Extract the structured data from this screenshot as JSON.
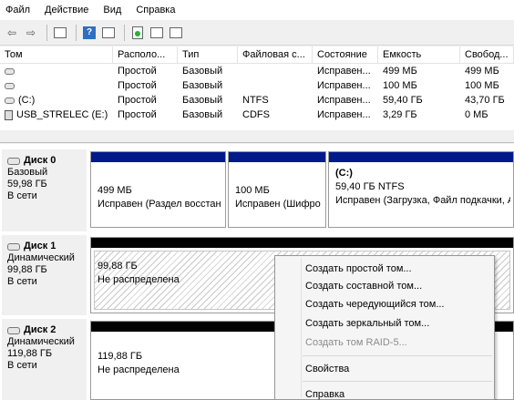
{
  "menu": [
    "Файл",
    "Действие",
    "Вид",
    "Справка"
  ],
  "toolbar": [
    "back-icon",
    "forward-icon",
    "console-tree-icon",
    "help-icon",
    "properties-icon",
    "refresh-icon",
    "rescan-icon",
    "view-icon"
  ],
  "volumes": {
    "columns": [
      "Том",
      "Располо...",
      "Тип",
      "Файловая с...",
      "Состояние",
      "Емкость",
      "Свобод..."
    ],
    "rows": [
      {
        "name": "",
        "layout": "Простой",
        "type": "Базовый",
        "fs": "",
        "status": "Исправен...",
        "capacity": "499 МБ",
        "free": "499 МБ"
      },
      {
        "name": "",
        "layout": "Простой",
        "type": "Базовый",
        "fs": "",
        "status": "Исправен...",
        "capacity": "100 МБ",
        "free": "100 МБ"
      },
      {
        "name": "(C:)",
        "layout": "Простой",
        "type": "Базовый",
        "fs": "NTFS",
        "status": "Исправен...",
        "capacity": "59,40 ГБ",
        "free": "43,70 ГБ"
      },
      {
        "name": "USB_STRELEC (E:)",
        "layout": "Простой",
        "type": "Базовый",
        "fs": "CDFS",
        "status": "Исправен...",
        "capacity": "3,29 ГБ",
        "free": "0 МБ"
      }
    ]
  },
  "disks": [
    {
      "title": "Диск 0",
      "kind": "Базовый",
      "size": "59,98 ГБ",
      "state": "В сети",
      "partitions": [
        {
          "label": "",
          "line1": "499 МБ",
          "line2": "Исправен (Раздел восстан"
        },
        {
          "label": "",
          "line1": "100 МБ",
          "line2": "Исправен (Шифро"
        },
        {
          "label": "(C:)",
          "line1": "59,40 ГБ NTFS",
          "line2": "Исправен (Загрузка, Файл подкачки, Ав"
        }
      ]
    },
    {
      "title": "Диск 1",
      "kind": "Динамический",
      "size": "99,88 ГБ",
      "state": "В сети",
      "partitions": [
        {
          "line1": "99,88 ГБ",
          "line2": "Не распределена"
        }
      ]
    },
    {
      "title": "Диск 2",
      "kind": "Динамический",
      "size": "119,88 ГБ",
      "state": "В сети",
      "partitions": [
        {
          "line1": "119,88 ГБ",
          "line2": "Не распределена"
        }
      ]
    }
  ],
  "context_menu": {
    "items": [
      {
        "label": "Создать простой том...",
        "enabled": true
      },
      {
        "label": "Создать составной том...",
        "enabled": true
      },
      {
        "label": "Создать чередующийся том...",
        "enabled": true
      },
      {
        "label": "Создать зеркальный том...",
        "enabled": true
      },
      {
        "label": "Создать том RAID-5...",
        "enabled": false
      },
      {
        "label": "Свойства",
        "enabled": true
      },
      {
        "label": "Справка",
        "enabled": true
      }
    ]
  },
  "colors": {
    "primary_partition": "#001a8c",
    "unallocated": "#000000"
  }
}
